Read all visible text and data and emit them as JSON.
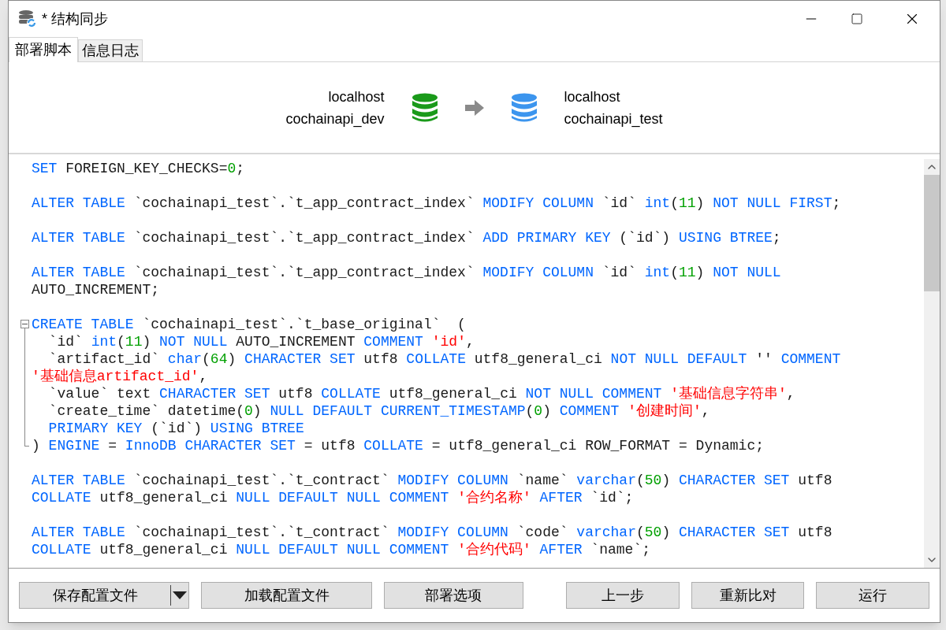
{
  "window": {
    "title": "* 结构同步"
  },
  "tabs": [
    {
      "label": "部署脚本",
      "selected": true
    },
    {
      "label": "信息日志",
      "selected": false
    }
  ],
  "source": {
    "host": "localhost",
    "database": "cochainapi_dev"
  },
  "target": {
    "host": "localhost",
    "database": "cochainapi_test"
  },
  "script": {
    "statements": [
      {
        "fold": false,
        "lines": [
          [
            {
              "kind": "kw",
              "text": "SET"
            },
            {
              "kind": "p",
              "text": " FOREIGN_KEY_CHECKS="
            },
            {
              "kind": "num",
              "text": "0"
            },
            {
              "kind": "p",
              "text": ";"
            }
          ]
        ]
      },
      {
        "fold": false,
        "lines": [
          [
            {
              "kind": "kw",
              "text": "ALTER TABLE"
            },
            {
              "kind": "p",
              "text": " `cochainapi_test`.`t_app_contract_index` "
            },
            {
              "kind": "kw",
              "text": "MODIFY COLUMN"
            },
            {
              "kind": "p",
              "text": " `id` "
            },
            {
              "kind": "kw",
              "text": "int"
            },
            {
              "kind": "p",
              "text": "("
            },
            {
              "kind": "num",
              "text": "11"
            },
            {
              "kind": "p",
              "text": ") "
            },
            {
              "kind": "kw",
              "text": "NOT NULL FIRST"
            },
            {
              "kind": "p",
              "text": ";"
            }
          ]
        ]
      },
      {
        "fold": false,
        "lines": [
          [
            {
              "kind": "kw",
              "text": "ALTER TABLE"
            },
            {
              "kind": "p",
              "text": " `cochainapi_test`.`t_app_contract_index` "
            },
            {
              "kind": "kw",
              "text": "ADD PRIMARY KEY"
            },
            {
              "kind": "p",
              "text": " (`id`) "
            },
            {
              "kind": "kw",
              "text": "USING BTREE"
            },
            {
              "kind": "p",
              "text": ";"
            }
          ]
        ]
      },
      {
        "fold": false,
        "lines": [
          [
            {
              "kind": "kw",
              "text": "ALTER TABLE"
            },
            {
              "kind": "p",
              "text": " `cochainapi_test`.`t_app_contract_index` "
            },
            {
              "kind": "kw",
              "text": "MODIFY COLUMN"
            },
            {
              "kind": "p",
              "text": " `id` "
            },
            {
              "kind": "kw",
              "text": "int"
            },
            {
              "kind": "p",
              "text": "("
            },
            {
              "kind": "num",
              "text": "11"
            },
            {
              "kind": "p",
              "text": ") "
            },
            {
              "kind": "kw",
              "text": "NOT NULL"
            }
          ],
          [
            {
              "kind": "p",
              "text": "AUTO_INCREMENT;"
            }
          ]
        ]
      },
      {
        "fold": true,
        "lines": [
          [
            {
              "kind": "kw",
              "text": "CREATE TABLE"
            },
            {
              "kind": "p",
              "text": " `cochainapi_test`.`t_base_original`  ("
            }
          ],
          [
            {
              "kind": "p",
              "text": "  `id` "
            },
            {
              "kind": "kw",
              "text": "int"
            },
            {
              "kind": "p",
              "text": "("
            },
            {
              "kind": "num",
              "text": "11"
            },
            {
              "kind": "p",
              "text": ") "
            },
            {
              "kind": "kw",
              "text": "NOT NULL"
            },
            {
              "kind": "p",
              "text": " AUTO_INCREMENT "
            },
            {
              "kind": "kw",
              "text": "COMMENT "
            },
            {
              "kind": "str",
              "text": "'id'"
            },
            {
              "kind": "p",
              "text": ","
            }
          ],
          [
            {
              "kind": "p",
              "text": "  `artifact_id` "
            },
            {
              "kind": "kw",
              "text": "char"
            },
            {
              "kind": "p",
              "text": "("
            },
            {
              "kind": "num",
              "text": "64"
            },
            {
              "kind": "p",
              "text": ") "
            },
            {
              "kind": "kw",
              "text": "CHARACTER SET"
            },
            {
              "kind": "p",
              "text": " utf8 "
            },
            {
              "kind": "kw",
              "text": "COLLATE"
            },
            {
              "kind": "p",
              "text": " utf8_general_ci "
            },
            {
              "kind": "kw",
              "text": "NOT NULL DEFAULT"
            },
            {
              "kind": "p",
              "text": " '' "
            },
            {
              "kind": "kw",
              "text": "COMMENT"
            }
          ],
          [
            {
              "kind": "str",
              "text": "'基础信息artifact_id'"
            },
            {
              "kind": "p",
              "text": ","
            }
          ],
          [
            {
              "kind": "p",
              "text": "  `value` text "
            },
            {
              "kind": "kw",
              "text": "CHARACTER SET"
            },
            {
              "kind": "p",
              "text": " utf8 "
            },
            {
              "kind": "kw",
              "text": "COLLATE"
            },
            {
              "kind": "p",
              "text": " utf8_general_ci "
            },
            {
              "kind": "kw",
              "text": "NOT NULL COMMENT "
            },
            {
              "kind": "str",
              "text": "'基础信息字符串'"
            },
            {
              "kind": "p",
              "text": ","
            }
          ],
          [
            {
              "kind": "p",
              "text": "  `create_time` datetime("
            },
            {
              "kind": "num",
              "text": "0"
            },
            {
              "kind": "p",
              "text": ") "
            },
            {
              "kind": "kw",
              "text": "NULL DEFAULT CURRENT_TIMESTAMP"
            },
            {
              "kind": "p",
              "text": "("
            },
            {
              "kind": "num",
              "text": "0"
            },
            {
              "kind": "p",
              "text": ") "
            },
            {
              "kind": "kw",
              "text": "COMMENT "
            },
            {
              "kind": "str",
              "text": "'创建时间'"
            },
            {
              "kind": "p",
              "text": ","
            }
          ],
          [
            {
              "kind": "kw",
              "text": "  PRIMARY KEY"
            },
            {
              "kind": "p",
              "text": " (`id`) "
            },
            {
              "kind": "kw",
              "text": "USING BTREE"
            }
          ],
          [
            {
              "kind": "p",
              "text": ") "
            },
            {
              "kind": "kw",
              "text": "ENGINE"
            },
            {
              "kind": "p",
              "text": " = "
            },
            {
              "kind": "kw",
              "text": "InnoDB CHARACTER SET"
            },
            {
              "kind": "p",
              "text": " = utf8 "
            },
            {
              "kind": "kw",
              "text": "COLLATE"
            },
            {
              "kind": "p",
              "text": " = utf8_general_ci ROW_FORMAT = Dynamic;"
            }
          ]
        ]
      },
      {
        "fold": false,
        "lines": [
          [
            {
              "kind": "kw",
              "text": "ALTER TABLE"
            },
            {
              "kind": "p",
              "text": " `cochainapi_test`.`t_contract` "
            },
            {
              "kind": "kw",
              "text": "MODIFY COLUMN"
            },
            {
              "kind": "p",
              "text": " `name` "
            },
            {
              "kind": "kw",
              "text": "varchar"
            },
            {
              "kind": "p",
              "text": "("
            },
            {
              "kind": "num",
              "text": "50"
            },
            {
              "kind": "p",
              "text": ") "
            },
            {
              "kind": "kw",
              "text": "CHARACTER SET"
            },
            {
              "kind": "p",
              "text": " utf8"
            }
          ],
          [
            {
              "kind": "kw",
              "text": "COLLATE"
            },
            {
              "kind": "p",
              "text": " utf8_general_ci "
            },
            {
              "kind": "kw",
              "text": "NULL DEFAULT NULL COMMENT "
            },
            {
              "kind": "str",
              "text": "'合约名称'"
            },
            {
              "kind": "kw",
              "text": " AFTER"
            },
            {
              "kind": "p",
              "text": " `id`;"
            }
          ]
        ]
      },
      {
        "fold": false,
        "lines": [
          [
            {
              "kind": "kw",
              "text": "ALTER TABLE"
            },
            {
              "kind": "p",
              "text": " `cochainapi_test`.`t_contract` "
            },
            {
              "kind": "kw",
              "text": "MODIFY COLUMN"
            },
            {
              "kind": "p",
              "text": " `code` "
            },
            {
              "kind": "kw",
              "text": "varchar"
            },
            {
              "kind": "p",
              "text": "("
            },
            {
              "kind": "num",
              "text": "50"
            },
            {
              "kind": "p",
              "text": ") "
            },
            {
              "kind": "kw",
              "text": "CHARACTER SET"
            },
            {
              "kind": "p",
              "text": " utf8"
            }
          ],
          [
            {
              "kind": "kw",
              "text": "COLLATE"
            },
            {
              "kind": "p",
              "text": " utf8_general_ci "
            },
            {
              "kind": "kw",
              "text": "NULL DEFAULT NULL COMMENT "
            },
            {
              "kind": "str",
              "text": "'合约代码'"
            },
            {
              "kind": "kw",
              "text": " AFTER"
            },
            {
              "kind": "p",
              "text": " `name`;"
            }
          ]
        ]
      }
    ]
  },
  "buttons": [
    {
      "label": "保存配置文件",
      "kind": "split"
    },
    {
      "label": "加载配置文件",
      "kind": "plain"
    },
    {
      "label": "部署选项",
      "kind": "plain"
    },
    {
      "label": "上一步",
      "kind": "plain"
    },
    {
      "label": "重新比对",
      "kind": "plain"
    },
    {
      "label": "运行",
      "kind": "plain"
    }
  ]
}
